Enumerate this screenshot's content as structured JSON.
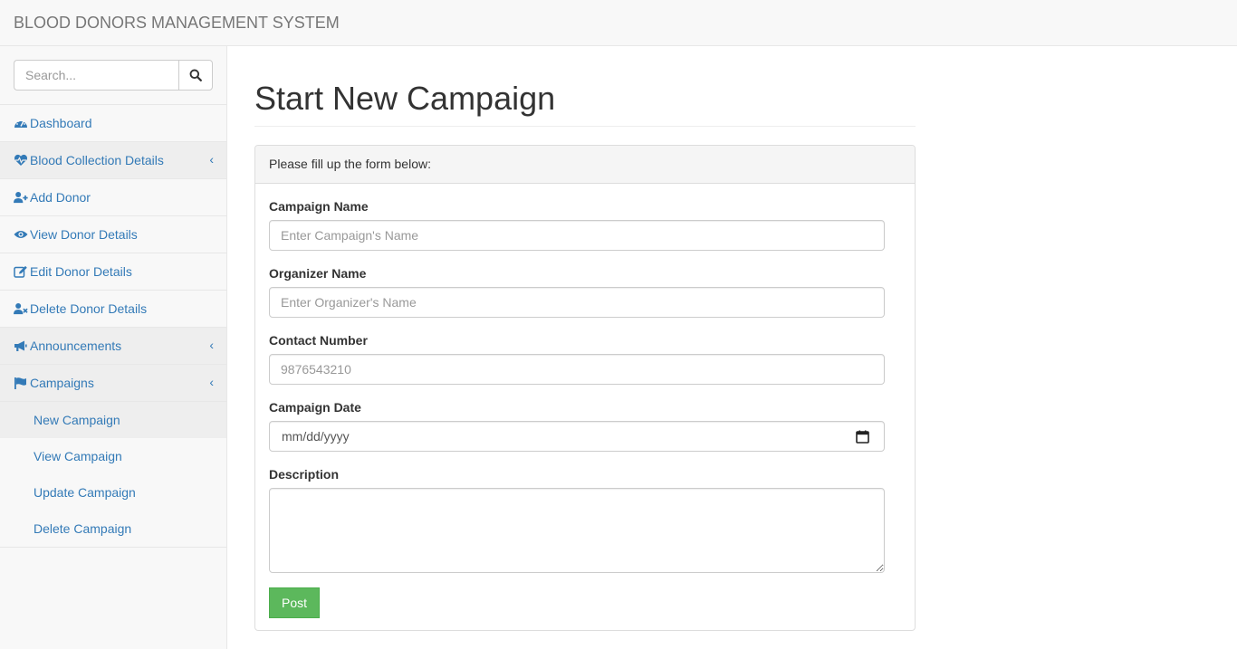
{
  "navbar": {
    "brand": "BLOOD DONORS MANAGEMENT SYSTEM"
  },
  "sidebar": {
    "search": {
      "placeholder": "Search..."
    },
    "items": [
      {
        "label": "Dashboard",
        "icon": "dashboard-icon"
      },
      {
        "label": "Blood Collection Details",
        "icon": "heartbeat-icon",
        "expandable": true
      },
      {
        "label": "Add Donor",
        "icon": "user-plus-icon"
      },
      {
        "label": "View Donor Details",
        "icon": "eye-icon"
      },
      {
        "label": "Edit Donor Details",
        "icon": "edit-icon"
      },
      {
        "label": "Delete Donor Details",
        "icon": "user-times-icon"
      },
      {
        "label": "Announcements",
        "icon": "bullhorn-icon",
        "expandable": true
      },
      {
        "label": "Campaigns",
        "icon": "flag-icon",
        "expandable": true
      }
    ],
    "caret": "‹",
    "campaigns_sub": [
      {
        "label": "New Campaign",
        "active": true
      },
      {
        "label": "View Campaign"
      },
      {
        "label": "Update Campaign"
      },
      {
        "label": "Delete Campaign"
      }
    ]
  },
  "main": {
    "title": "Start New Campaign",
    "panel_heading": "Please fill up the form below:",
    "form": {
      "campaign_name": {
        "label": "Campaign Name",
        "placeholder": "Enter Campaign's Name"
      },
      "organizer_name": {
        "label": "Organizer Name",
        "placeholder": "Enter Organizer's Name"
      },
      "contact_number": {
        "label": "Contact Number",
        "placeholder": "9876543210"
      },
      "campaign_date": {
        "label": "Campaign Date",
        "placeholder": "mm/dd/yyyy"
      },
      "description": {
        "label": "Description",
        "value": ""
      },
      "submit_label": "Post"
    }
  },
  "colors": {
    "link": "#337ab7",
    "success": "#5cb85c",
    "sidebar_bg": "#f8f8f8",
    "active_bg": "#eeeeee"
  }
}
